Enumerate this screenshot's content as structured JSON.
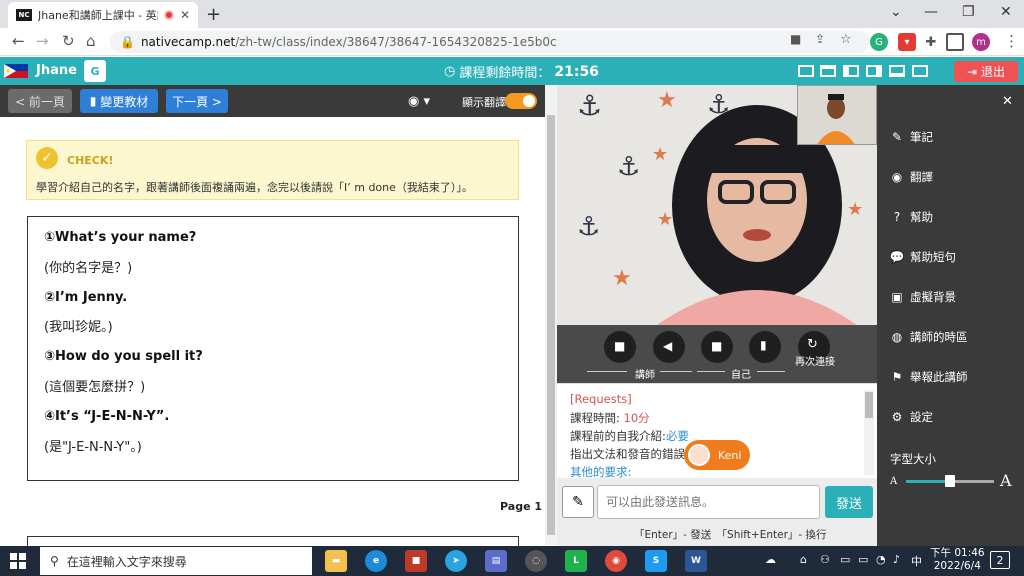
{
  "browser": {
    "tab_title": "Jhane和講師上課中 - 英語",
    "tab_favicon": "NC",
    "url_host": "nativecamp.net",
    "url_path": "/zh-tw/class/index/38647/38647-1654320825-1e5b0c",
    "profile_initial": "m"
  },
  "header": {
    "teacher_name": "Jhane",
    "translate_icon": "G",
    "timer_label": "課程剩餘時間：",
    "timer_value": "21:56",
    "exit_label": "退出"
  },
  "material_toolbar": {
    "prev_label": "< 前一頁",
    "change_label": "變更教材",
    "next_label": "下一頁 >",
    "show_translation_label": "顯示翻譯",
    "show_translation_on": true
  },
  "material": {
    "check_title": "CHECK!",
    "check_desc": "學習介紹自己的名字，跟著講師後面複誦兩遍，念完以後請說「I’ m done（我結束了）」。",
    "lines": [
      {
        "q": "①What’s your name?",
        "t": "(你的名字是？)"
      },
      {
        "q": "②I’m Jenny.",
        "t": "(我叫珍妮。)"
      },
      {
        "q": "③How do you spell it?",
        "t": "(這個要怎麼拼？)"
      },
      {
        "q": "④It’s “J-E-N-N-Y”.",
        "t": "(是\"J-E-N-N-Y\"。)"
      }
    ],
    "page_label": "Page 1"
  },
  "video_controls": {
    "teacher_label": "講師",
    "self_label": "自己",
    "reconnect_label": "再次連接"
  },
  "chat": {
    "requests_title": "[Requests]",
    "duration_label": "課程時間:",
    "duration_value": "10分",
    "intro_label": "課程前的自我介紹:",
    "intro_value": "必要",
    "correction_label": "指出文法和發音的錯誤",
    "other_label": "其他的要求:",
    "teacher_badge": "Keni",
    "input_placeholder": "可以由此發送訊息。",
    "send_label": "發送",
    "hint": "「Enter」- 發送　「Shift+Enter」- 換行"
  },
  "right_menu": {
    "items": [
      {
        "icon": "edit-icon",
        "label": "筆記"
      },
      {
        "icon": "globe-icon",
        "label": "翻譯"
      },
      {
        "icon": "help-icon",
        "label": "幫助"
      },
      {
        "icon": "chat-bubble-icon",
        "label": "幫助短句"
      },
      {
        "icon": "image-icon",
        "label": "虛擬背景"
      },
      {
        "icon": "world-clock-icon",
        "label": "講師的時區"
      },
      {
        "icon": "flag-icon",
        "label": "舉報此講師"
      },
      {
        "icon": "gear-icon",
        "label": "設定"
      }
    ],
    "font_size_label": "字型大小",
    "font_small": "A",
    "font_large": "A",
    "font_size_value": 0.5
  },
  "taskbar": {
    "search_placeholder": "在這裡輸入文字來搜尋",
    "time": "下午 01:46",
    "date": "2022/6/4",
    "ime": "中",
    "notifications": "2"
  },
  "colors": {
    "brand": "#2ab0b6",
    "exit": "#ee5253",
    "toggle": "#f29a1f",
    "primary_button": "#2e7fd6"
  }
}
